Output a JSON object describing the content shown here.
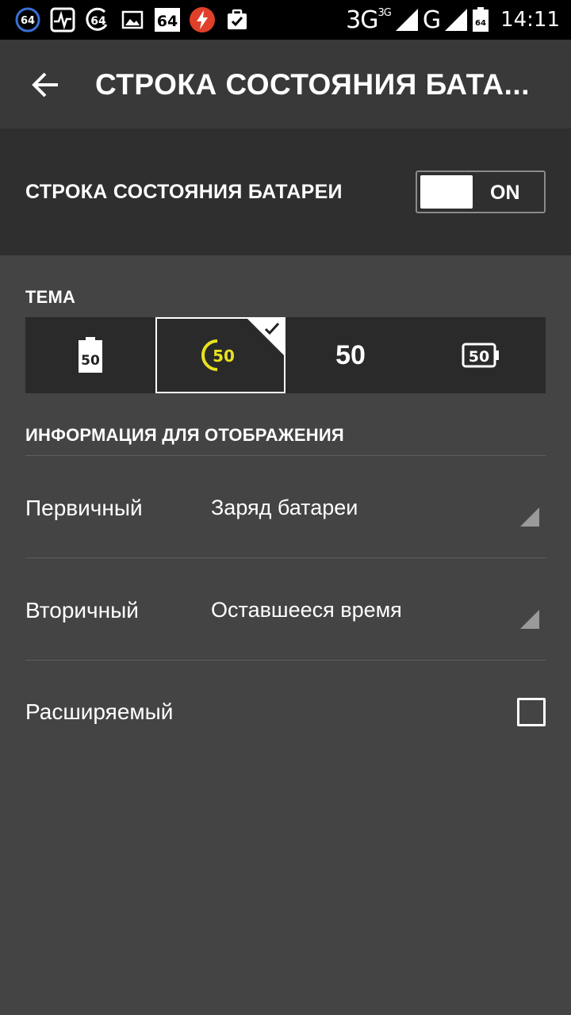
{
  "statusbar": {
    "icons": [
      "64",
      "pulse-icon",
      "64",
      "image-icon",
      "64",
      "flash-icon",
      "clipboard-check-icon"
    ],
    "network_1": "3G",
    "network_1_sup": "3G",
    "network_2": "G",
    "battery_level": "64",
    "time": "14:11"
  },
  "toolbar": {
    "title": "СТРОКА СОСТОЯНИЯ БАТА..."
  },
  "master": {
    "label": "СТРОКА СОСТОЯНИЯ БАТАРЕИ",
    "switch_state": "ON"
  },
  "theme": {
    "header": "ТЕМА",
    "options": [
      {
        "label": "50",
        "style": "battery-fill"
      },
      {
        "label": "50",
        "style": "ring",
        "selected": true
      },
      {
        "label": "50",
        "style": "text"
      },
      {
        "label": "50",
        "style": "battery-outline"
      }
    ],
    "selected_color": "#e8e21f"
  },
  "info": {
    "header": "ИНФОРМАЦИЯ ДЛЯ ОТОБРАЖЕНИЯ",
    "primary_label": "Первичный",
    "primary_value": "Заряд батареи",
    "secondary_label": "Вторичный",
    "secondary_value": "Оставшееся время",
    "expandable_label": "Расширяемый",
    "expandable_checked": false
  }
}
